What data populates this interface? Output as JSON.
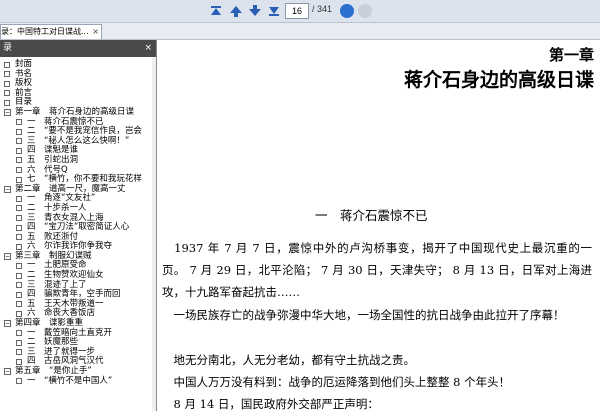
{
  "toolbar": {
    "page_current": "16",
    "page_total": "/ 341",
    "icons": [
      "first-page-icon",
      "prev-page-icon",
      "next-page-icon",
      "last-page-icon"
    ]
  },
  "tab": {
    "label": "录：中国特工对日谍战...",
    "close": "×"
  },
  "sidebar": {
    "title": "录",
    "close": "×",
    "items": [
      {
        "label": "封面",
        "indent": 0,
        "type": "box"
      },
      {
        "label": "书名",
        "indent": 0,
        "type": "box"
      },
      {
        "label": "版权",
        "indent": 0,
        "type": "box"
      },
      {
        "label": "前言",
        "indent": 0,
        "type": "box"
      },
      {
        "label": "目录",
        "indent": 0,
        "type": "box"
      },
      {
        "label": "第一章　蒋介石身边的高级日谍",
        "indent": 0,
        "type": "exp"
      },
      {
        "label": "一　蒋介石震惊不已",
        "indent": 1,
        "type": "box"
      },
      {
        "label": "二　“要不是我宠信作良，岂会",
        "indent": 1,
        "type": "box"
      },
      {
        "label": "三　“秘人怎么这么快啊！”",
        "indent": 1,
        "type": "box"
      },
      {
        "label": "四　谍魁是谁",
        "indent": 1,
        "type": "box"
      },
      {
        "label": "五　引蛇出洞",
        "indent": 1,
        "type": "box"
      },
      {
        "label": "六　代号Q",
        "indent": 1,
        "type": "box"
      },
      {
        "label": "七　“横竹，你不要和我玩花样",
        "indent": 1,
        "type": "box"
      },
      {
        "label": "第二章　道高一尺，魔高一丈",
        "indent": 0,
        "type": "exp"
      },
      {
        "label": "一　角逐“文友社”",
        "indent": 1,
        "type": "box"
      },
      {
        "label": "二　十步杀一人",
        "indent": 1,
        "type": "box"
      },
      {
        "label": "三　青衣女混入上海",
        "indent": 1,
        "type": "box"
      },
      {
        "label": "四　“宝刀法”取密简证人心",
        "indent": 1,
        "type": "box"
      },
      {
        "label": "五　败还浙付",
        "indent": 1,
        "type": "box"
      },
      {
        "label": "六　尔诈我诈你争我夺",
        "indent": 1,
        "type": "box"
      },
      {
        "label": "第三章　制服幻谍贼",
        "indent": 0,
        "type": "exp"
      },
      {
        "label": "一　土肥原受命",
        "indent": 1,
        "type": "box"
      },
      {
        "label": "二　生物赞欢迎仙女",
        "indent": 1,
        "type": "box"
      },
      {
        "label": "三　混迹了上了",
        "indent": 1,
        "type": "box"
      },
      {
        "label": "四　骗欺青年，空手而回",
        "indent": 1,
        "type": "box"
      },
      {
        "label": "五　王天木带叛道一",
        "indent": 1,
        "type": "box"
      },
      {
        "label": "六　命丧大香饭店",
        "indent": 1,
        "type": "box"
      },
      {
        "label": "第四章　谍影重重",
        "indent": 0,
        "type": "exp"
      },
      {
        "label": "一　戴笠暗向土直克开",
        "indent": 1,
        "type": "box"
      },
      {
        "label": "二　妖魔那些",
        "indent": 1,
        "type": "box"
      },
      {
        "label": "三　进了就得一步",
        "indent": 1,
        "type": "box"
      },
      {
        "label": "四　古岳风洞气汉代",
        "indent": 1,
        "type": "box"
      },
      {
        "label": "第五章　“是你止手”",
        "indent": 0,
        "type": "exp"
      },
      {
        "label": "一　“横竹不是中国人”",
        "indent": 1,
        "type": "box"
      }
    ]
  },
  "document": {
    "chapter_no": "第一章",
    "chapter_title": "蒋介石身边的高级日谍",
    "section_title": "一　蒋介石震惊不已",
    "paragraphs": [
      "　1937 年 7 月 7 日，震惊中外的卢沟桥事变，揭开了中国现代史上最沉重的一页。 7 月 29 日，北平沦陷； 7 月 30 日，天津失守； 8 月 13 日，日军对上海进攻，十九路军奋起抗击……",
      "　一场民族存亡的战争弥漫中华大地，一场全国性的抗日战争由此拉开了序幕！",
      "　地无分南北，人无分老幼，都有守土抗战之责。",
      "　中国人万万没有料到：战争的厄运降落到他们头上整整 8 个年头！",
      "　8 月 14 日，国民政府外交部严正声明："
    ]
  }
}
